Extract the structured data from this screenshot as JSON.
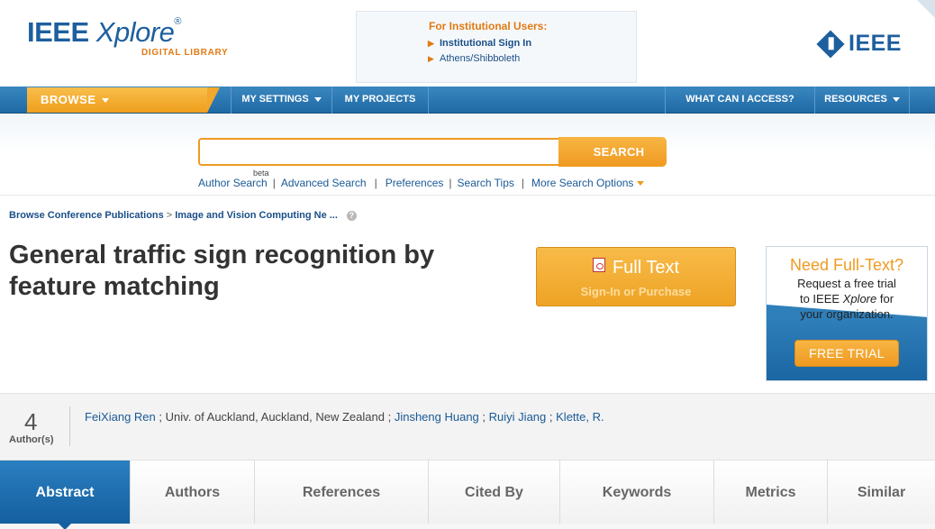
{
  "brand": {
    "logo_ieee": "IEEE",
    "logo_xplore": "Xplore",
    "logo_reg": "®",
    "logo_sub": "DIGITAL LIBRARY",
    "ieee_word": "IEEE"
  },
  "institutional": {
    "title": "For Institutional Users:",
    "links": [
      "Institutional Sign In",
      "Athens/Shibboleth"
    ]
  },
  "nav": {
    "browse": "BROWSE",
    "my_settings": "MY SETTINGS",
    "my_projects": "MY PROJECTS",
    "what_can_i_access": "WHAT CAN I ACCESS?",
    "resources": "RESOURCES"
  },
  "search": {
    "value": "",
    "button": "SEARCH",
    "beta": "beta",
    "links": [
      "Author Search",
      "Advanced Search",
      "Preferences",
      "Search Tips",
      "More Search Options"
    ]
  },
  "breadcrumb": {
    "items": [
      "Browse Conference Publications",
      "Image and Vision Computing Ne ..."
    ],
    "help": "?"
  },
  "document": {
    "title": "General traffic sign recognition by feature matching"
  },
  "fulltext": {
    "title": "Full Text",
    "subtitle": "Sign-In or Purchase"
  },
  "promo": {
    "title": "Need Full-Text?",
    "text_1": "Request a free trial",
    "text_2a": "to IEEE ",
    "text_2b": "Xplore",
    "text_2c": " for",
    "text_3": "your organization.",
    "button": "FREE TRIAL"
  },
  "authors": {
    "count": "4",
    "count_label": "Author(s)",
    "list": [
      {
        "name": "FeiXiang Ren",
        "affiliation": "Univ. of Auckland, Auckland, New Zealand"
      },
      {
        "name": "Jinsheng Huang",
        "affiliation": ""
      },
      {
        "name": "Ruiyi Jiang",
        "affiliation": ""
      },
      {
        "name": "Klette, R.",
        "affiliation": ""
      }
    ],
    "separator": ";"
  },
  "tabs": [
    "Abstract",
    "Authors",
    "References",
    "Cited By",
    "Keywords",
    "Metrics",
    "Similar"
  ],
  "active_tab": "Abstract",
  "colors": {
    "brand_blue": "#1d5f9e",
    "accent_orange": "#ef9a22",
    "nav_blue": "#1f6aa5"
  }
}
